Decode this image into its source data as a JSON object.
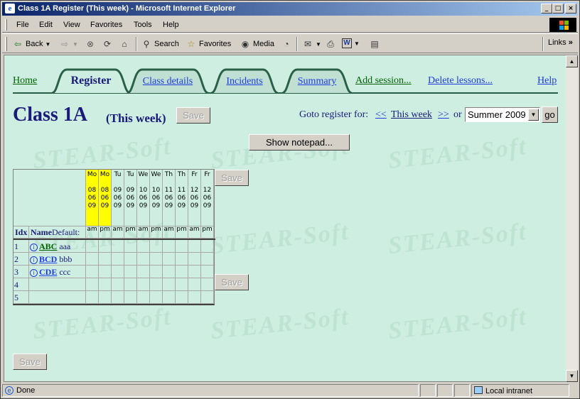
{
  "window": {
    "title": "Class 1A Register (This week) - Microsoft Internet Explorer",
    "minimize": "_",
    "maximize": "□",
    "close": "×"
  },
  "menubar": [
    "File",
    "Edit",
    "View",
    "Favorites",
    "Tools",
    "Help"
  ],
  "toolbar": {
    "back": "Back",
    "search": "Search",
    "favorites": "Favorites",
    "media": "Media",
    "links": "Links",
    "chevron": "»"
  },
  "nav": {
    "home": "Home",
    "register": "Register",
    "class_details": "Class details",
    "incidents": "Incidents",
    "summary": "Summary",
    "add_session": "Add session...",
    "delete_lessons": "Delete lessons...",
    "help": "Help"
  },
  "header": {
    "title": "Class 1A",
    "subtitle": "(This week)",
    "save": "Save"
  },
  "goto": {
    "label": "Goto register for:",
    "prev": "<<",
    "current": "This week",
    "next": ">>",
    "or": "or",
    "term_selected": "Summer 2009",
    "go": "go"
  },
  "notepad_button": "Show notepad...",
  "save_label": "Save",
  "watermark": "STEAR-Soft",
  "grid": {
    "idx_header": "Idx",
    "name_header": "Name",
    "default_label": "Default:",
    "columns": [
      {
        "day": "Mo",
        "date": [
          "08",
          "06",
          "09"
        ],
        "session": "am",
        "highlight": true
      },
      {
        "day": "Mo",
        "date": [
          "08",
          "06",
          "09"
        ],
        "session": "pm",
        "highlight": true
      },
      {
        "day": "Tu",
        "date": [
          "09",
          "06",
          "09"
        ],
        "session": "am",
        "highlight": false
      },
      {
        "day": "Tu",
        "date": [
          "09",
          "06",
          "09"
        ],
        "session": "pm",
        "highlight": false
      },
      {
        "day": "We",
        "date": [
          "10",
          "06",
          "09"
        ],
        "session": "am",
        "highlight": false
      },
      {
        "day": "We",
        "date": [
          "10",
          "06",
          "09"
        ],
        "session": "pm",
        "highlight": false
      },
      {
        "day": "Th",
        "date": [
          "11",
          "06",
          "09"
        ],
        "session": "am",
        "highlight": false
      },
      {
        "day": "Th",
        "date": [
          "11",
          "06",
          "09"
        ],
        "session": "pm",
        "highlight": false
      },
      {
        "day": "Fr",
        "date": [
          "12",
          "06",
          "09"
        ],
        "session": "am",
        "highlight": false
      },
      {
        "day": "Fr",
        "date": [
          "12",
          "06",
          "09"
        ],
        "session": "pm",
        "highlight": false
      }
    ],
    "rows": [
      {
        "idx": "1",
        "code": "ABC",
        "desc": "aaa"
      },
      {
        "idx": "2",
        "code": "BCD",
        "desc": "bbb"
      },
      {
        "idx": "3",
        "code": "CDE",
        "desc": "ccc"
      },
      {
        "idx": "4",
        "code": "",
        "desc": ""
      },
      {
        "idx": "5",
        "code": "",
        "desc": ""
      }
    ]
  },
  "statusbar": {
    "done": "Done",
    "zone": "Local intranet"
  }
}
